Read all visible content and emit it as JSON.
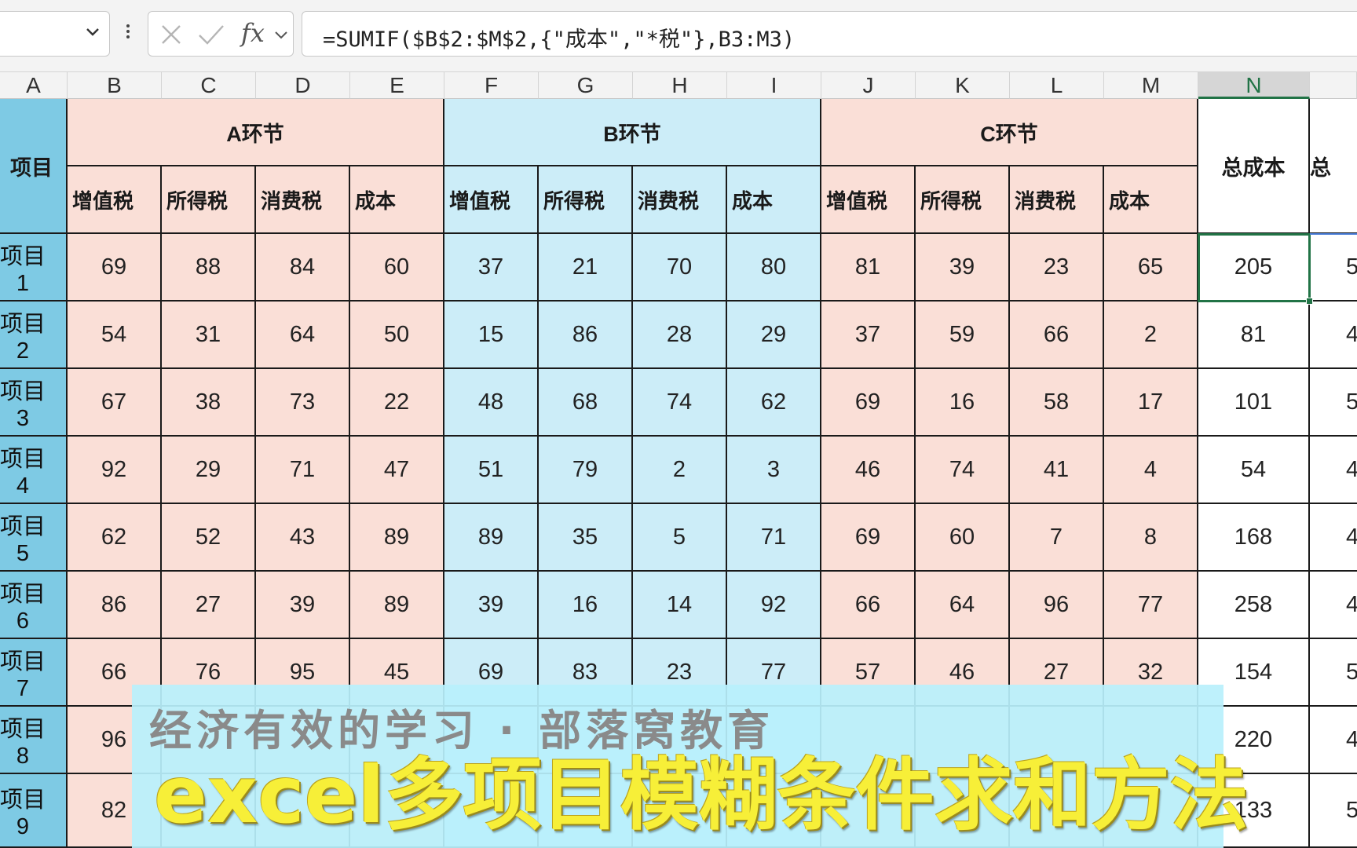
{
  "formula_bar": {
    "name_box": "",
    "formula": "=SUMIF($B$2:$M$2,{\"成本\",\"*税\"},B3:M3)"
  },
  "columns": [
    "A",
    "B",
    "C",
    "D",
    "E",
    "F",
    "G",
    "H",
    "I",
    "J",
    "K",
    "L",
    "M",
    "N",
    ""
  ],
  "selected_column": "N",
  "sections": {
    "row_label": "项目",
    "a": "A环节",
    "b": "B环节",
    "c": "C环节",
    "total_cost": "总成本",
    "total_tax_partial": "总",
    "sub_headers": [
      "增值税",
      "所得税",
      "消费税",
      "成本"
    ]
  },
  "rows": [
    {
      "label": "项目1",
      "values": [
        "69",
        "88",
        "84",
        "60",
        "37",
        "21",
        "70",
        "80",
        "81",
        "39",
        "23",
        "65"
      ],
      "total": "205",
      "extra": "5"
    },
    {
      "label": "项目2",
      "values": [
        "54",
        "31",
        "64",
        "50",
        "15",
        "86",
        "28",
        "29",
        "37",
        "59",
        "66",
        "2"
      ],
      "total": "81",
      "extra": "4"
    },
    {
      "label": "项目3",
      "values": [
        "67",
        "38",
        "73",
        "22",
        "48",
        "68",
        "74",
        "62",
        "69",
        "16",
        "58",
        "17"
      ],
      "total": "101",
      "extra": "5"
    },
    {
      "label": "项目4",
      "values": [
        "92",
        "29",
        "71",
        "47",
        "51",
        "79",
        "2",
        "3",
        "46",
        "74",
        "41",
        "4"
      ],
      "total": "54",
      "extra": "4"
    },
    {
      "label": "项目5",
      "values": [
        "62",
        "52",
        "43",
        "89",
        "89",
        "35",
        "5",
        "71",
        "69",
        "60",
        "7",
        "8"
      ],
      "total": "168",
      "extra": "4"
    },
    {
      "label": "项目6",
      "values": [
        "86",
        "27",
        "39",
        "89",
        "39",
        "16",
        "14",
        "92",
        "66",
        "64",
        "96",
        "77"
      ],
      "total": "258",
      "extra": "4"
    },
    {
      "label": "项目7",
      "values": [
        "66",
        "76",
        "95",
        "45",
        "69",
        "83",
        "23",
        "77",
        "57",
        "46",
        "27",
        "32"
      ],
      "total": "154",
      "extra": "5"
    },
    {
      "label": "项目8",
      "values": [
        "96",
        "",
        "",
        "",
        "",
        "",
        "",
        "",
        "",
        "",
        "",
        ""
      ],
      "total": "220",
      "extra": "4"
    },
    {
      "label": "项目9",
      "values": [
        "82",
        "",
        "",
        "",
        "",
        "",
        "",
        "",
        "",
        "",
        "",
        ""
      ],
      "total": "133",
      "extra": "5"
    }
  ],
  "banner": {
    "subtitle": "经济有效的学习 · 部落窝教育",
    "title": "excel多项目模糊条件求和方法"
  },
  "colors": {
    "pink": "#fadfd7",
    "blue": "#ccedf8",
    "project": "#7ecae4",
    "selection": "#217346",
    "banner_bg": "#b9f0fc",
    "banner_title": "#f7ef38"
  }
}
